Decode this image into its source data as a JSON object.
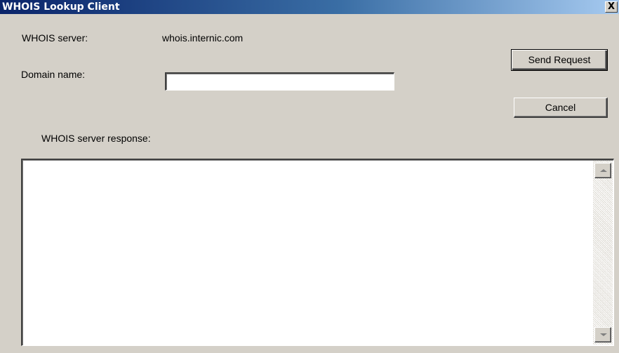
{
  "window": {
    "title": "WHOIS Lookup Client",
    "close_glyph": "X"
  },
  "form": {
    "server_label": "WHOIS server:",
    "server_value": "whois.internic.com",
    "domain_label": "Domain name:",
    "domain_value": "",
    "response_label": "WHOIS server response:",
    "response_value": ""
  },
  "buttons": {
    "send_label": "Send Request",
    "cancel_label": "Cancel"
  },
  "icons": {
    "close": "close-icon",
    "scroll_up": "scroll-up-arrow-icon",
    "scroll_down": "scroll-down-arrow-icon"
  },
  "colors": {
    "titlebar_start": "#0a246a",
    "titlebar_end": "#a6caf0",
    "window_face": "#d4d0c8"
  }
}
